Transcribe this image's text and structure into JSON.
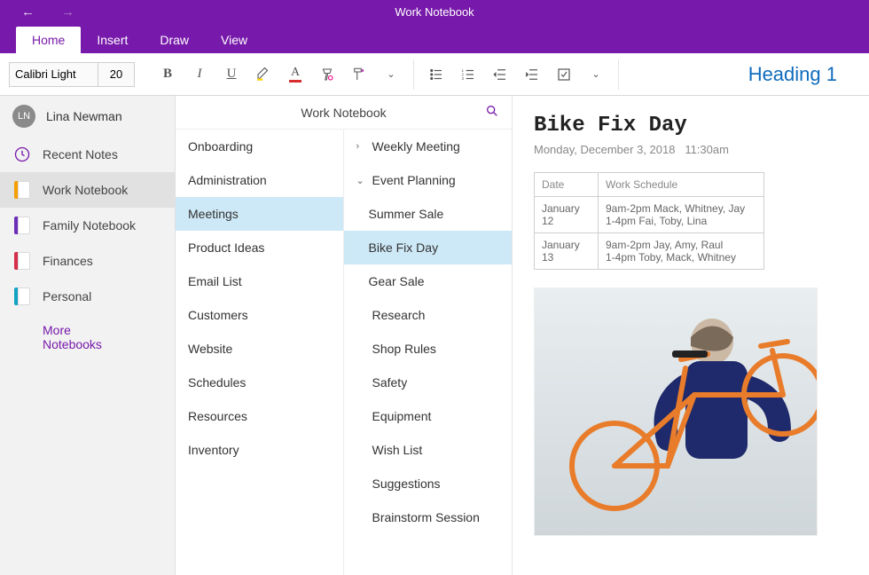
{
  "titlebar": {
    "title": "Work Notebook"
  },
  "ribbon": {
    "tabs": [
      {
        "label": "Home",
        "active": true
      },
      {
        "label": "Insert",
        "active": false
      },
      {
        "label": "Draw",
        "active": false
      },
      {
        "label": "View",
        "active": false
      }
    ],
    "font_name": "Calibri Light",
    "font_size": "20",
    "style_preview": "Heading 1"
  },
  "user": {
    "initials": "LN",
    "name": "Lina Newman"
  },
  "sidebar": {
    "recent_label": "Recent Notes",
    "notebooks": [
      {
        "label": "Work Notebook",
        "color": "#f59f00",
        "active": true
      },
      {
        "label": "Family Notebook",
        "color": "#6c2eb9",
        "active": false
      },
      {
        "label": "Finances",
        "color": "#d62e4a",
        "active": false
      },
      {
        "label": "Personal",
        "color": "#12a3c4",
        "active": false
      }
    ],
    "more_label": "More Notebooks"
  },
  "sections": {
    "header": "Work Notebook",
    "items": [
      {
        "label": "Onboarding",
        "color": "#b93fb3",
        "active": false
      },
      {
        "label": "Administration",
        "color": "#e23fa0",
        "active": false
      },
      {
        "label": "Meetings",
        "color": "#15a0d4",
        "active": true
      },
      {
        "label": "Product Ideas",
        "color": "#0ea56d",
        "active": false
      },
      {
        "label": "Email List",
        "color": "#6fb51f",
        "active": false
      },
      {
        "label": "Customers",
        "color": "#d6c81f",
        "active": false
      },
      {
        "label": "Website",
        "color": "#f5a51f",
        "active": false
      },
      {
        "label": "Schedules",
        "color": "#ee6a1f",
        "active": false
      },
      {
        "label": "Resources",
        "color": "#e44125",
        "active": false
      },
      {
        "label": "Inventory",
        "color": "#c23434",
        "active": false
      }
    ]
  },
  "pages": {
    "items": [
      {
        "label": "Weekly Meeting",
        "expander": "chevron-right",
        "indent": 0,
        "active": false
      },
      {
        "label": "Event Planning",
        "expander": "chevron-down",
        "indent": 0,
        "active": false
      },
      {
        "label": "Summer Sale",
        "expander": "",
        "indent": 1,
        "active": false
      },
      {
        "label": "Bike Fix Day",
        "expander": "",
        "indent": 1,
        "active": true
      },
      {
        "label": "Gear Sale",
        "expander": "",
        "indent": 1,
        "active": false
      },
      {
        "label": "Research",
        "expander": "",
        "indent": 0,
        "active": false
      },
      {
        "label": "Shop Rules",
        "expander": "",
        "indent": 0,
        "active": false
      },
      {
        "label": "Safety",
        "expander": "",
        "indent": 0,
        "active": false
      },
      {
        "label": "Equipment",
        "expander": "",
        "indent": 0,
        "active": false
      },
      {
        "label": "Wish List",
        "expander": "",
        "indent": 0,
        "active": false
      },
      {
        "label": "Suggestions",
        "expander": "",
        "indent": 0,
        "active": false
      },
      {
        "label": "Brainstorm Session",
        "expander": "",
        "indent": 0,
        "active": false
      }
    ]
  },
  "content": {
    "title": "Bike Fix Day",
    "date": "Monday, December 3, 2018",
    "time": "11:30am",
    "table": {
      "headers": [
        "Date",
        "Work Schedule"
      ],
      "rows": [
        {
          "date": "January 12",
          "schedule_line1": "9am-2pm Mack, Whitney, Jay",
          "schedule_line2": "1-4pm Fai, Toby, Lina"
        },
        {
          "date": "January 13",
          "schedule_line1": "9am-2pm Jay, Amy, Raul",
          "schedule_line2": "1-4pm Toby, Mack, Whitney"
        }
      ]
    }
  }
}
